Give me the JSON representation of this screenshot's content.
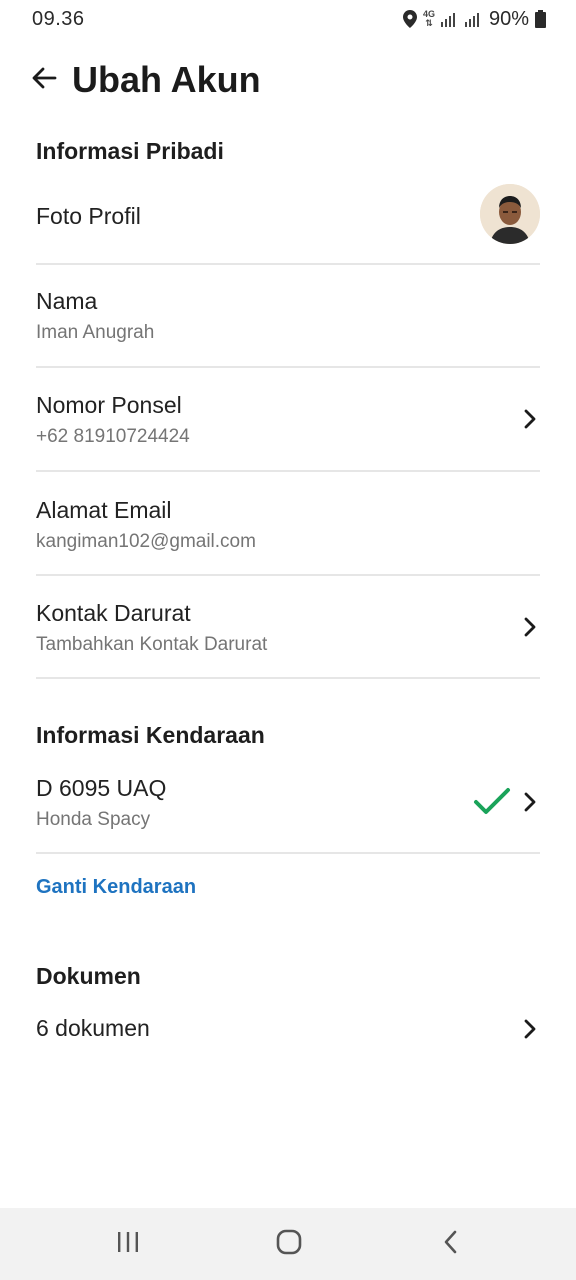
{
  "status_bar": {
    "time": "09.36",
    "network": "4G",
    "battery": "90%"
  },
  "header": {
    "title": "Ubah Akun"
  },
  "personal": {
    "section_title": "Informasi Pribadi",
    "photo_label": "Foto Profil",
    "name_label": "Nama",
    "name_value": "Iman Anugrah",
    "phone_label": "Nomor Ponsel",
    "phone_value": "+62 81910724424",
    "email_label": "Alamat Email",
    "email_value": "kangiman102@gmail.com",
    "emergency_label": "Kontak Darurat",
    "emergency_value": "Tambahkan Kontak Darurat"
  },
  "vehicle": {
    "section_title": "Informasi Kendaraan",
    "plate": "D 6095 UAQ",
    "model": "Honda Spacy",
    "change_link": "Ganti Kendaraan"
  },
  "documents": {
    "section_title": "Dokumen",
    "count_label": "6 dokumen"
  },
  "colors": {
    "accent_link": "#1e73c0",
    "verified_check": "#1aa35a"
  },
  "icons": {
    "back": "arrow-left-icon",
    "chevron": "chevron-right-icon",
    "verified": "check-icon",
    "nav_recents": "recents-icon",
    "nav_home": "home-icon",
    "nav_back": "nav-back-icon"
  }
}
